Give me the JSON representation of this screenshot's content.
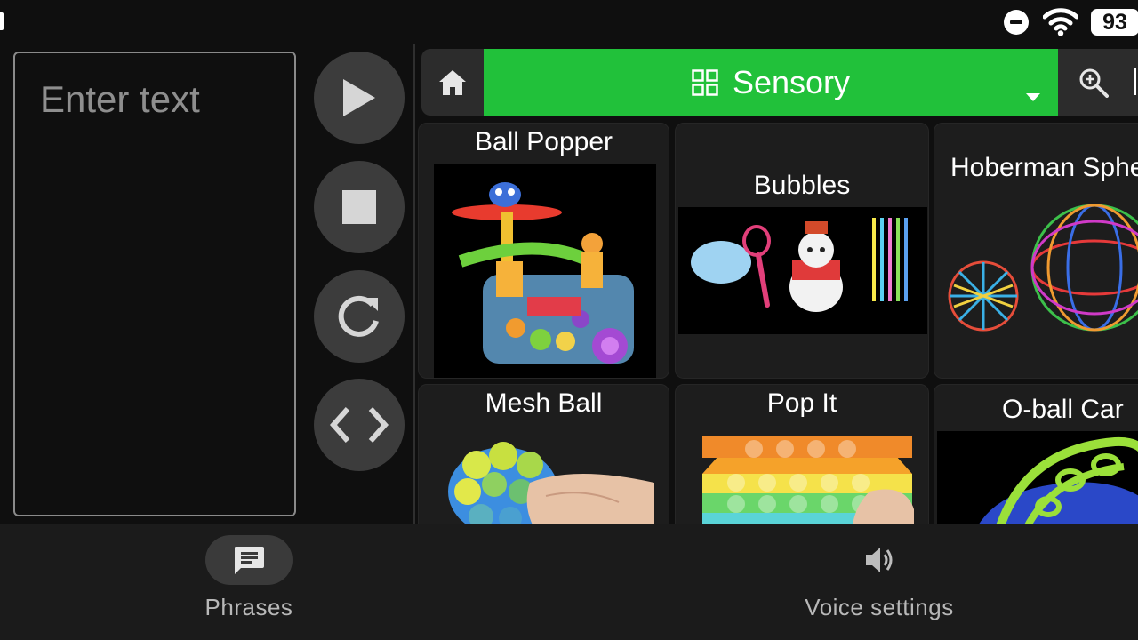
{
  "status_bar": {
    "battery_level": "93",
    "icons": [
      "do-not-disturb-icon",
      "wifi-icon",
      "battery-icon"
    ]
  },
  "text_entry": {
    "placeholder": "Enter text"
  },
  "controls": {
    "icons": [
      "play-icon",
      "stop-icon",
      "refresh-icon",
      "code-icon"
    ]
  },
  "category": {
    "title": "Sensory",
    "icons": [
      "home-icon",
      "grid-icon",
      "dropdown-arrow-icon",
      "zoom-in-icon"
    ],
    "color": "#21c13a"
  },
  "tiles": [
    {
      "label": "Ball Popper"
    },
    {
      "label": "Bubbles"
    },
    {
      "label": "Hoberman Sphere"
    },
    {
      "label": "Mesh Ball"
    },
    {
      "label": "Pop It"
    },
    {
      "label": "O-ball Car"
    }
  ],
  "bottom_nav": {
    "items": [
      {
        "label": "Phrases",
        "icon": "message-icon",
        "active": true
      },
      {
        "label": "Voice settings",
        "icon": "speaker-icon",
        "active": false
      }
    ]
  }
}
